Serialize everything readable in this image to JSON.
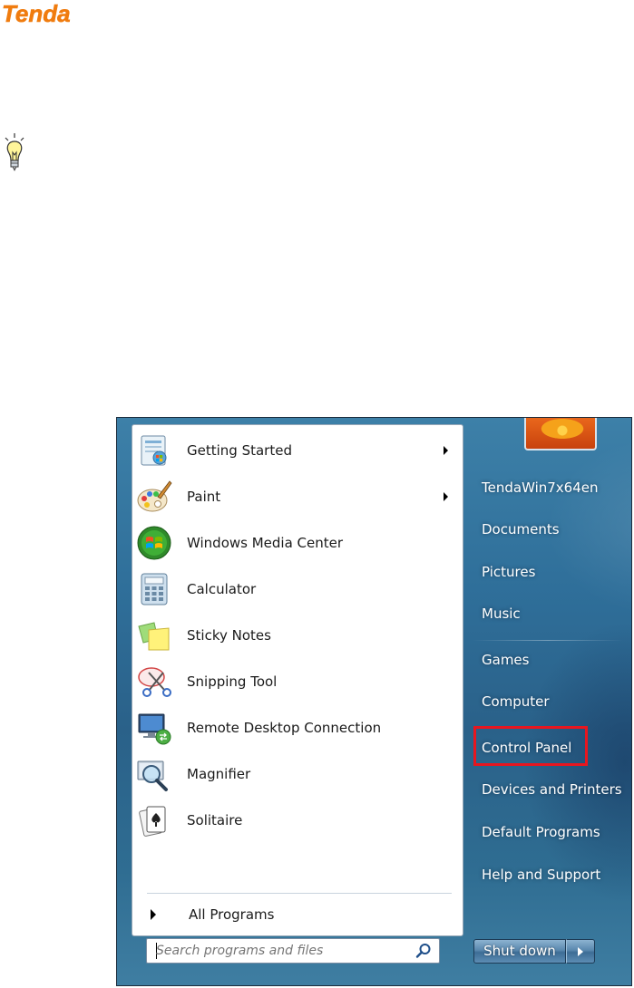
{
  "logo": {
    "text": "Tenda"
  },
  "start_menu": {
    "programs": [
      {
        "label": "Getting Started",
        "icon": "getting-started-icon",
        "has_submenu": true
      },
      {
        "label": "Paint",
        "icon": "paint-icon",
        "has_submenu": true
      },
      {
        "label": "Windows Media Center",
        "icon": "windows-media-center-icon",
        "has_submenu": false
      },
      {
        "label": "Calculator",
        "icon": "calculator-icon",
        "has_submenu": false
      },
      {
        "label": "Sticky Notes",
        "icon": "sticky-notes-icon",
        "has_submenu": false
      },
      {
        "label": "Snipping Tool",
        "icon": "snipping-tool-icon",
        "has_submenu": false
      },
      {
        "label": "Remote Desktop Connection",
        "icon": "remote-desktop-icon",
        "has_submenu": false
      },
      {
        "label": "Magnifier",
        "icon": "magnifier-icon",
        "has_submenu": false
      },
      {
        "label": "Solitaire",
        "icon": "solitaire-icon",
        "has_submenu": false
      }
    ],
    "all_programs": "All Programs",
    "search": {
      "placeholder": "Search programs and files"
    },
    "right_items": [
      "TendaWin7x64en",
      "Documents",
      "Pictures",
      "Music",
      "Games",
      "Computer",
      "Control Panel",
      "Devices and Printers",
      "Default Programs",
      "Help and Support"
    ],
    "highlighted_item": "Control Panel",
    "shutdown": {
      "label": "Shut down"
    }
  },
  "colors": {
    "highlight": "#e8161f",
    "logo": "#f07c0f",
    "panel": "#2f6d92"
  }
}
